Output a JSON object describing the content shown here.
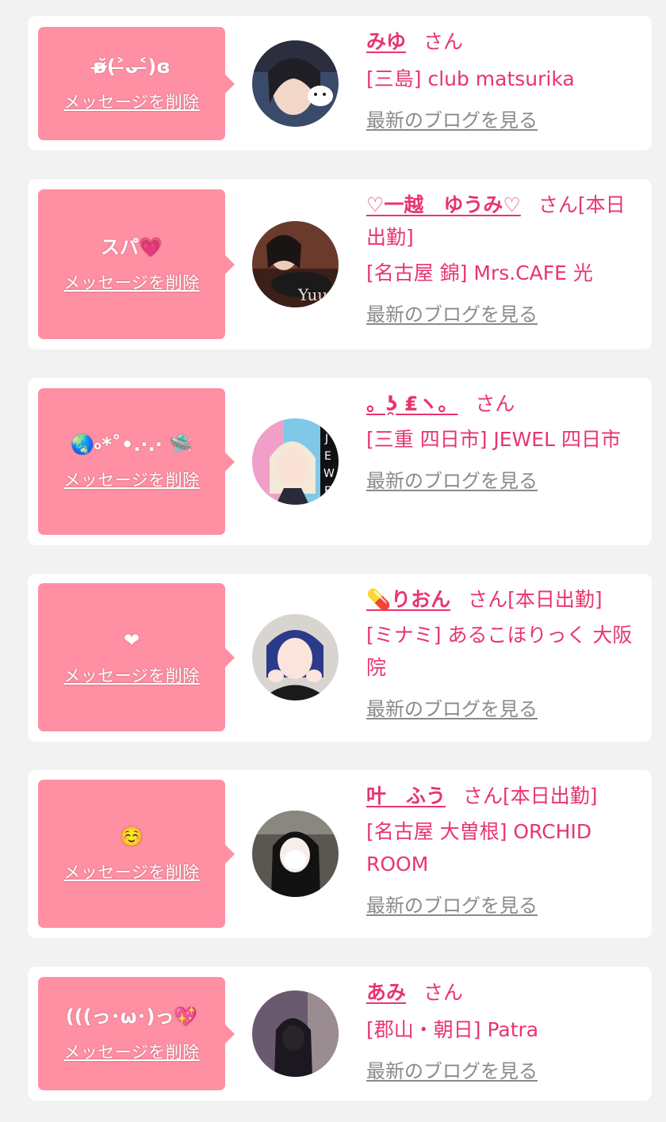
{
  "colors": {
    "page_bg": "#f2f2f2",
    "card_bg": "#ffffff",
    "bubble_bg": "#ff8fa3",
    "accent_text": "#e8356d",
    "link_gray": "#8a8a8a"
  },
  "cards": [
    {
      "message": "ʚ̴̶̷̆(˃̶ᴗ˂̶)ɞ",
      "delete_label": "メッセージを削除",
      "name": "みゆ",
      "suffix": "さん",
      "shop": "[三島] club matsurika",
      "blog_link": "最新のブログを見る"
    },
    {
      "message": "スパ💗",
      "delete_label": "メッセージを削除",
      "name": "♡一越　ゆうみ♡",
      "suffix": "さん[本日出勤]",
      "shop": "[名古屋 錦] Mrs.CAFE 光",
      "blog_link": "最新のブログを見る"
    },
    {
      "message": "🌏৹*˚•.·.· 🛸",
      "delete_label": "メッセージを削除",
      "name": "。ʖ̯ ₤ヽ。",
      "suffix": "さん",
      "shop": "[三重 四日市] JEWEL 四日市",
      "blog_link": "最新のブログを見る"
    },
    {
      "message": "❤",
      "delete_label": "メッセージを削除",
      "name": "💊りおん",
      "suffix": "さん[本日出勤]",
      "shop": "[ミナミ] あるこほりっく 大阪院",
      "blog_link": "最新のブログを見る"
    },
    {
      "message": "☺️",
      "delete_label": "メッセージを削除",
      "name": "叶　ふう",
      "suffix": "さん[本日出勤]",
      "shop": "[名古屋 大曽根] ORCHID ROOM",
      "blog_link": "最新のブログを見る"
    },
    {
      "message": "(((っ･ω･)っ💖",
      "delete_label": "メッセージを削除",
      "name": "あみ",
      "suffix": "さん",
      "shop": "[郡山・朝日] Patra",
      "blog_link": "最新のブログを見る"
    }
  ]
}
